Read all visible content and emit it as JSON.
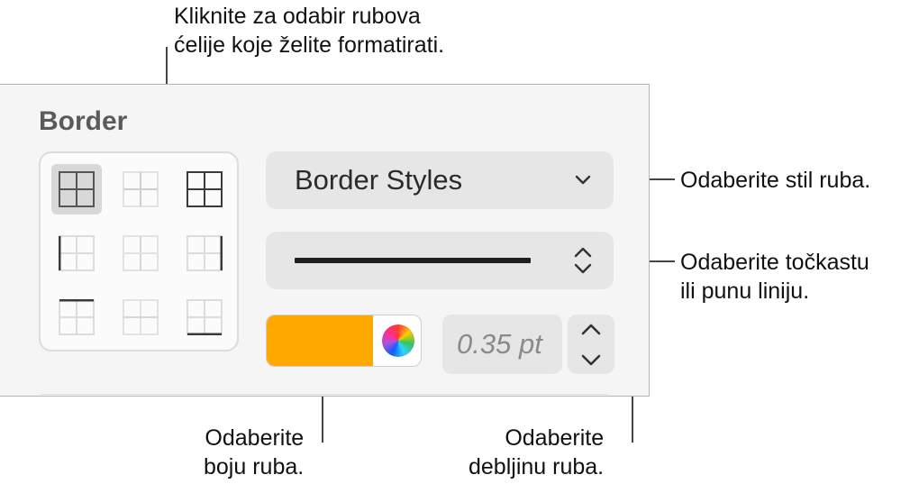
{
  "callouts": {
    "top_line1": "Kliknite za odabir rubova",
    "top_line2": "ćelije koje želite formatirati.",
    "style": "Odaberite stil ruba.",
    "line_line1": "Odaberite točkastu",
    "line_line2": "ili punu liniju.",
    "color_line1": "Odaberite",
    "color_line2": "boju ruba.",
    "width_line1": "Odaberite",
    "width_line2": "debljinu ruba."
  },
  "panel": {
    "title": "Border",
    "border_styles_label": "Border Styles",
    "border_color": "#FFA800",
    "thickness_value": "0.35 pt"
  },
  "icons": {
    "style_dropdown": "chevron-down-icon",
    "line_dropdown": "chevron-up-down-icon",
    "color_picker": "color-wheel-icon",
    "stepper_up": "chevron-up-icon",
    "stepper_down": "chevron-down-icon"
  },
  "border_options": [
    "all-borders",
    "inside-borders",
    "outside-borders",
    "left-border",
    "inside-vertical-border",
    "right-border",
    "top-border",
    "inside-horizontal-border",
    "bottom-border"
  ],
  "selected_border_option": "all-borders"
}
